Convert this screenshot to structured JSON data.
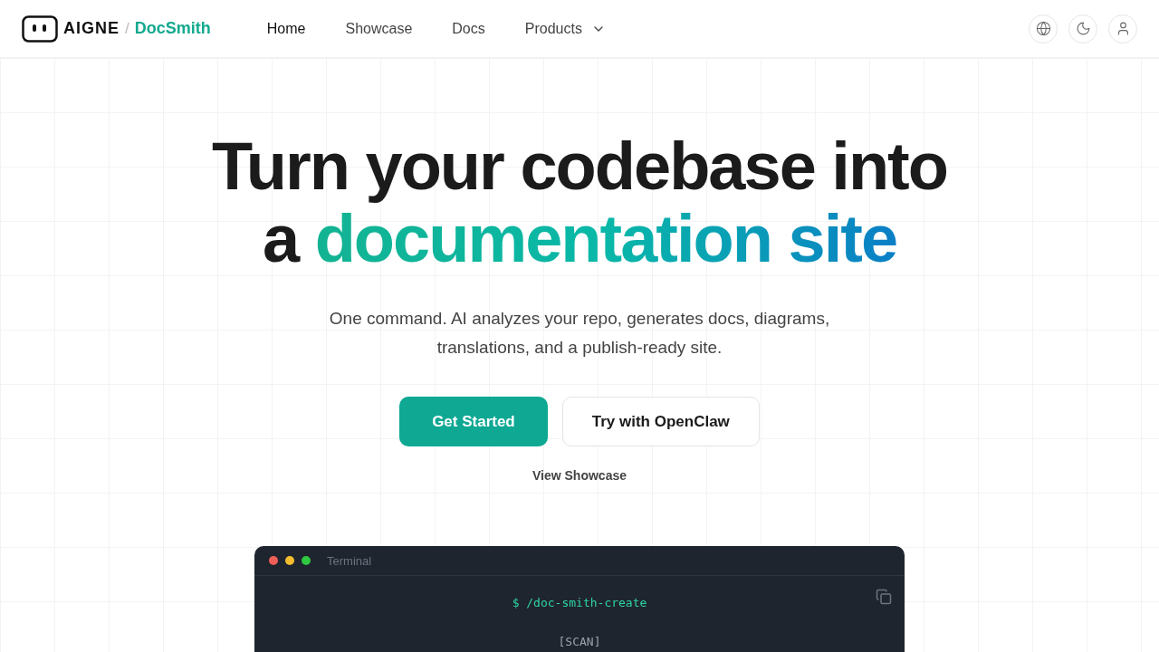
{
  "brand": {
    "name": "AIGNE",
    "separator": "/",
    "product": "DocSmith"
  },
  "nav": [
    {
      "label": "Home",
      "selected": true,
      "dropdown": false
    },
    {
      "label": "Showcase",
      "selected": false,
      "dropdown": false
    },
    {
      "label": "Docs",
      "selected": false,
      "dropdown": false
    },
    {
      "label": "Products",
      "selected": false,
      "dropdown": true
    }
  ],
  "hero": {
    "title_line1": "Turn your codebase into",
    "title_line2_prefix": "a",
    "title_highlight": "documentation site",
    "subtitle": "One command. AI analyzes your repo, generates docs, diagrams, translations, and a publish-ready site.",
    "primary_button": "Get Started",
    "secondary_button": "Try with OpenClaw",
    "link": "View Showcase"
  },
  "terminal": {
    "title": "Terminal",
    "command": "$ /doc-smith-create",
    "lines": [
      "[SCAN]"
    ]
  }
}
